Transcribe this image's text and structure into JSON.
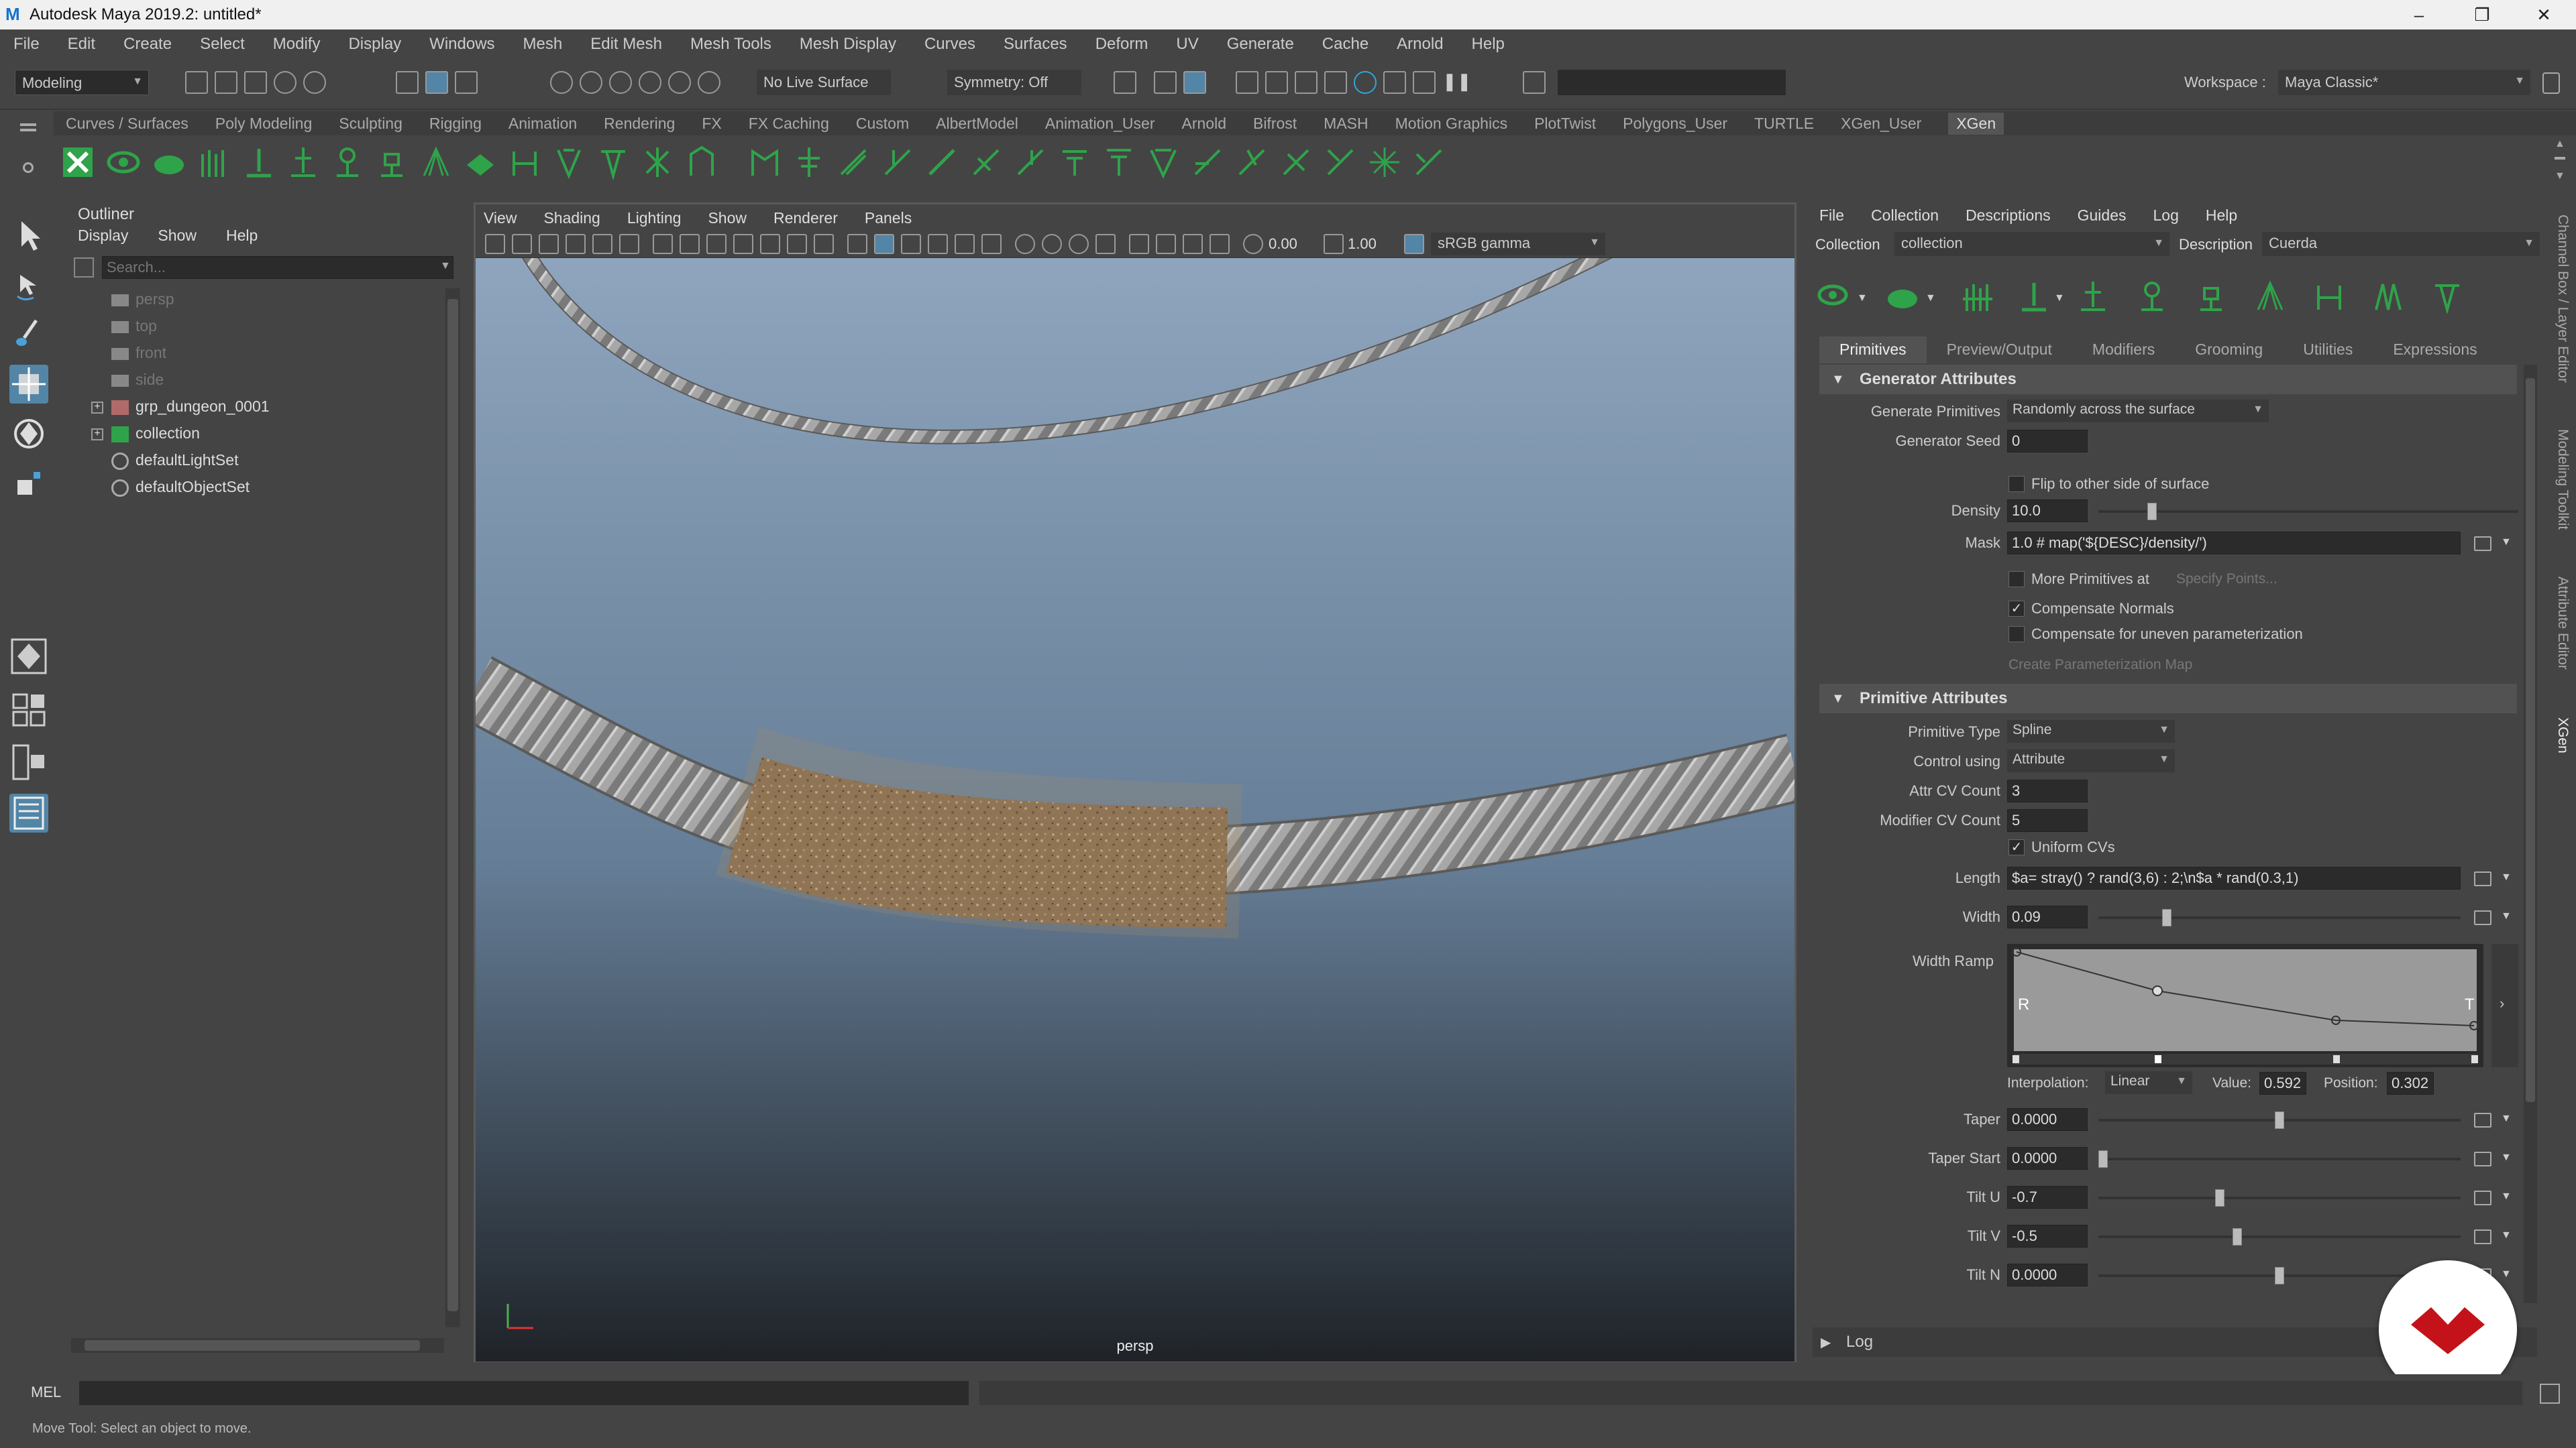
{
  "app": {
    "title": "Autodesk Maya 2019.2: untitled*",
    "window_buttons": [
      "–",
      "❐",
      "✕"
    ]
  },
  "menubar": [
    "File",
    "Edit",
    "Create",
    "Select",
    "Modify",
    "Display",
    "Windows",
    "Mesh",
    "Edit Mesh",
    "Mesh Tools",
    "Mesh Display",
    "Curves",
    "Surfaces",
    "Deform",
    "UV",
    "Generate",
    "Cache",
    "Arnold",
    "Help"
  ],
  "status": {
    "mode": "Modeling",
    "live_surface": "No Live Surface",
    "symmetry": "Symmetry: Off",
    "workspace_label": "Workspace :",
    "workspace": "Maya Classic*"
  },
  "shelf_tabs": [
    "Curves / Surfaces",
    "Poly Modeling",
    "Sculpting",
    "Rigging",
    "Animation",
    "Rendering",
    "FX",
    "FX Caching",
    "Custom",
    "AlbertModel",
    "Animation_User",
    "Arnold",
    "Bifrost",
    "MASH",
    "Motion Graphics",
    "PlotTwist",
    "Polygons_User",
    "TURTLE",
    "XGen_User",
    "XGen"
  ],
  "outliner": {
    "title": "Outliner",
    "menu": [
      "Display",
      "Show",
      "Help"
    ],
    "search_placeholder": "Search...",
    "items": [
      {
        "label": "persp",
        "dim": true
      },
      {
        "label": "top",
        "dim": true
      },
      {
        "label": "front",
        "dim": true
      },
      {
        "label": "side",
        "dim": true
      },
      {
        "label": "grp_dungeon_0001",
        "dim": false
      },
      {
        "label": "collection",
        "dim": false
      },
      {
        "label": "defaultLightSet",
        "dim": false
      },
      {
        "label": "defaultObjectSet",
        "dim": false
      }
    ]
  },
  "viewport": {
    "menu": [
      "View",
      "Shading",
      "Lighting",
      "Show",
      "Renderer",
      "Panels"
    ],
    "near": "0.00",
    "far": "1.00",
    "color_space": "sRGB gamma",
    "camera_label": "persp"
  },
  "xgen": {
    "menu": [
      "File",
      "Collection",
      "Descriptions",
      "Guides",
      "Log",
      "Help"
    ],
    "collection_label": "Collection",
    "collection_value": "collection",
    "description_label": "Description",
    "description_value": "Cuerda",
    "tabs": [
      "Primitives",
      "Preview/Output",
      "Modifiers",
      "Grooming",
      "Utilities",
      "Expressions"
    ],
    "gen_section": "Generator Attributes",
    "generate_primitives_label": "Generate Primitives",
    "generate_primitives_value": "Randomly across the surface",
    "seed_label": "Generator Seed",
    "seed_value": "0",
    "flip_label": "Flip to other side of surface",
    "density_label": "Density",
    "density_value": "10.0",
    "density_level": 0.12,
    "mask_label": "Mask",
    "mask_value": "1.0 # map('${DESC}/density/')",
    "more_prims_label": "More Primitives at",
    "specify_points": "Specify Points...",
    "comp_normals_label": "Compensate Normals",
    "comp_normals_checked": "✓",
    "comp_param_label": "Compensate for uneven parameterization",
    "create_param_map": "Create Parameterization Map",
    "prim_section": "Primitive Attributes",
    "ptype_label": "Primitive Type",
    "ptype_value": "Spline",
    "control_label": "Control using",
    "control_value": "Attribute",
    "attr_cv_label": "Attr CV Count",
    "attr_cv_value": "3",
    "mod_cv_label": "Modifier CV Count",
    "mod_cv_value": "5",
    "uniform_label": "Uniform CVs",
    "uniform_checked": "✓",
    "length_label": "Length",
    "length_value": "$a= stray() ? rand(3,6) : 2;\\n$a * rand(0.3,1)",
    "width_label": "Width",
    "width_value": "0.09",
    "width_level": 0.18,
    "ramp_label": "Width Ramp",
    "ramp_r": "R",
    "ramp_t": "T",
    "interp_label": "Interpolation:",
    "interp_value": "Linear",
    "value_label": "Value:",
    "value_value": "0.592",
    "position_label": "Position:",
    "position_value": "0.302",
    "taper_label": "Taper",
    "taper_value": "0.0000",
    "taper_level": 0.5,
    "taper_start_label": "Taper Start",
    "taper_start_value": "0.0000",
    "taper_start_level": 0.0,
    "tiltu_label": "Tilt U",
    "tiltu_value": "-0.7",
    "tiltu_level": 0.33,
    "tiltv_label": "Tilt V",
    "tiltv_value": "-0.5",
    "tiltv_level": 0.38,
    "tiltn_label": "Tilt N",
    "tiltn_value": "0.0000",
    "tiltn_level": 0.5,
    "log_label": "Log"
  },
  "right_tabs": [
    "Channel Box / Layer Editor",
    "Modeling Toolkit",
    "Attribute Editor",
    "XGen"
  ],
  "cmd": {
    "lang": "MEL"
  },
  "help_line": "Move Tool: Select an object to move.",
  "colors": {
    "bg": "#444444",
    "accent": "#5285a6",
    "rope": "#a9a9a9",
    "hair": "#8c7152",
    "brand_red": "#c4121a"
  }
}
